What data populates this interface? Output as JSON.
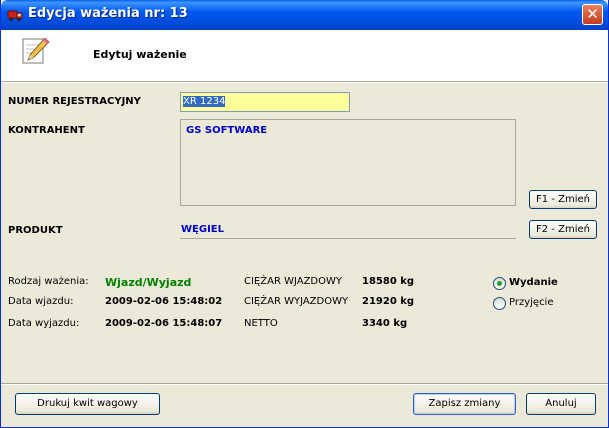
{
  "window": {
    "title": "Edycja ważenia nr: 13",
    "close_glyph": "✕",
    "title_icon": "truck-icon"
  },
  "header": {
    "title": "Edytuj ważenie",
    "icon": "pencil-icon"
  },
  "form": {
    "plate_label": "NUMER REJESTRACYJNY",
    "plate_value": "XR 1234",
    "contractor_label": "KONTRAHENT",
    "contractor_value": "GS SOFTWARE",
    "change_contractor_button": "F1 - Zmień",
    "product_label": "PRODUKT",
    "product_value": "WĘGIEL",
    "change_product_button": "F2 - Zmień"
  },
  "details": {
    "weighing_type_label": "Rodzaj ważenia:",
    "weighing_type_value": "Wjazd/Wyjazd",
    "entry_date_label": "Data wjazdu:",
    "entry_date_value": "2009-02-06 15:48:02",
    "exit_date_label": "Data wyjazdu:",
    "exit_date_value": "2009-02-06 15:48:07",
    "entry_weight_label": "CIĘŻAR WJAZDOWY",
    "entry_weight_value": "18580 kg",
    "exit_weight_label": "CIĘŻAR WYJAZDOWY",
    "exit_weight_value": "21920 kg",
    "net_label": "NETTO",
    "net_value": "3340 kg"
  },
  "direction": {
    "options": [
      "Wydanie",
      "Przyjęcie"
    ],
    "selected": "Wydanie"
  },
  "footer": {
    "print_button": "Drukuj kwit wagowy",
    "save_button": "Zapisz zmiany",
    "cancel_button": "Anuluj"
  },
  "colors": {
    "contractor_text": "#0000cc",
    "weighing_type_text": "#008000",
    "plate_bg": "#ffff99",
    "radio_dot": "#21a121"
  }
}
